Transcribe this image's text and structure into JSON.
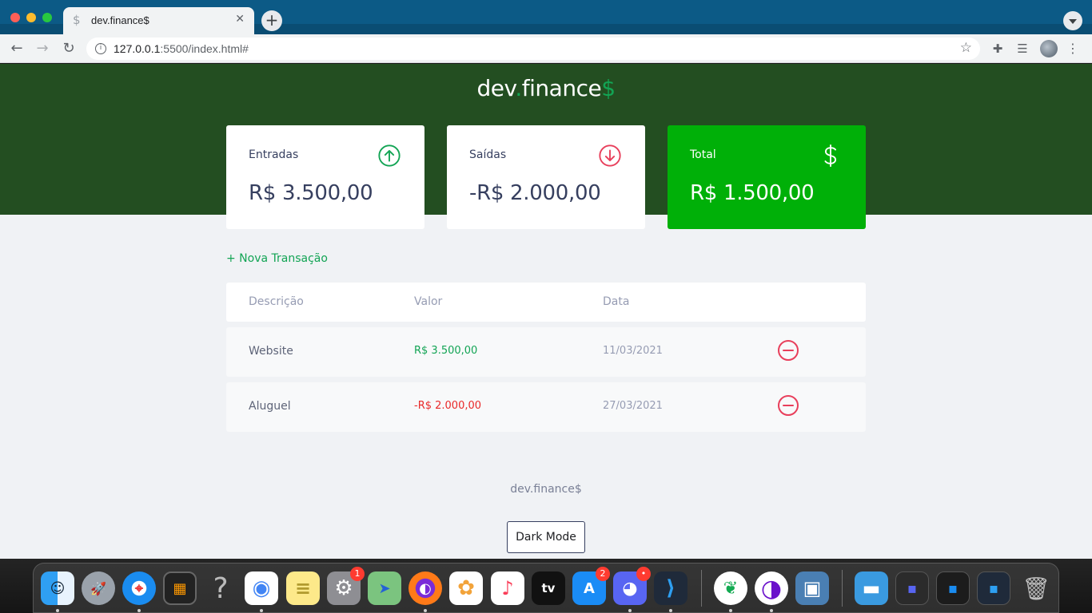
{
  "browser": {
    "tab_title": "dev.finance$",
    "tab_favicon": "$",
    "close_glyph": "✕",
    "new_tab_glyph": "+",
    "url_host": "127.0.0.1",
    "url_path": ":5500/index.html#"
  },
  "app": {
    "logo_main": "dev",
    "logo_dot": ".",
    "logo_rest": "finance",
    "logo_dollar": "$",
    "colors": {
      "header": "#234e21",
      "accent_green": "#12a454",
      "total_card": "#00b008",
      "expense_red": "#e92929"
    }
  },
  "cards": {
    "income": {
      "label": "Entradas",
      "value": "R$ 3.500,00",
      "icon": "arrow-up-circle-icon"
    },
    "expense": {
      "label": "Saídas",
      "value": "-R$ 2.000,00",
      "icon": "arrow-down-circle-icon"
    },
    "total": {
      "label": "Total",
      "value": "R$ 1.500,00",
      "icon": "dollar-icon"
    }
  },
  "new_transaction": "+ Nova Transação",
  "table": {
    "headers": [
      "Descrição",
      "Valor",
      "Data"
    ],
    "rows": [
      {
        "description": "Website",
        "amount": "R$ 3.500,00",
        "date": "11/03/2021",
        "type": "income"
      },
      {
        "description": "Aluguel",
        "amount": "-R$ 2.000,00",
        "date": "27/03/2021",
        "type": "expense"
      }
    ]
  },
  "footer": "dev.finance$",
  "dark_mode_button": "Dark Mode",
  "dock": {
    "apps": [
      {
        "name": "finder",
        "glyph": "☺"
      },
      {
        "name": "launchpad",
        "glyph": "🚀"
      },
      {
        "name": "safari",
        "glyph": "⌖"
      },
      {
        "name": "screen-app",
        "glyph": "▦"
      },
      {
        "name": "help",
        "glyph": "?"
      },
      {
        "name": "chrome",
        "glyph": "◉"
      },
      {
        "name": "notes",
        "glyph": "≡"
      },
      {
        "name": "system-preferences",
        "glyph": "⚙",
        "badge": "1"
      },
      {
        "name": "maps",
        "glyph": "➤"
      },
      {
        "name": "firefox",
        "glyph": "◐"
      },
      {
        "name": "photos",
        "glyph": "✿"
      },
      {
        "name": "music",
        "glyph": "♪"
      },
      {
        "name": "apple-tv",
        "glyph": "tv"
      },
      {
        "name": "app-store",
        "glyph": "A",
        "badge": "2"
      },
      {
        "name": "discord",
        "glyph": "◕",
        "badge": "•"
      },
      {
        "name": "vscode",
        "glyph": "⟩"
      },
      {
        "name": "mongodb",
        "glyph": "❦"
      },
      {
        "name": "tor",
        "glyph": "◑"
      },
      {
        "name": "preview",
        "glyph": "▣"
      },
      {
        "name": "downloads-folder",
        "glyph": "▬"
      },
      {
        "name": "window-discord",
        "glyph": "▪"
      },
      {
        "name": "window-safari",
        "glyph": "▪"
      },
      {
        "name": "window-vscode",
        "glyph": "▪"
      },
      {
        "name": "trash",
        "glyph": "🗑"
      }
    ]
  }
}
